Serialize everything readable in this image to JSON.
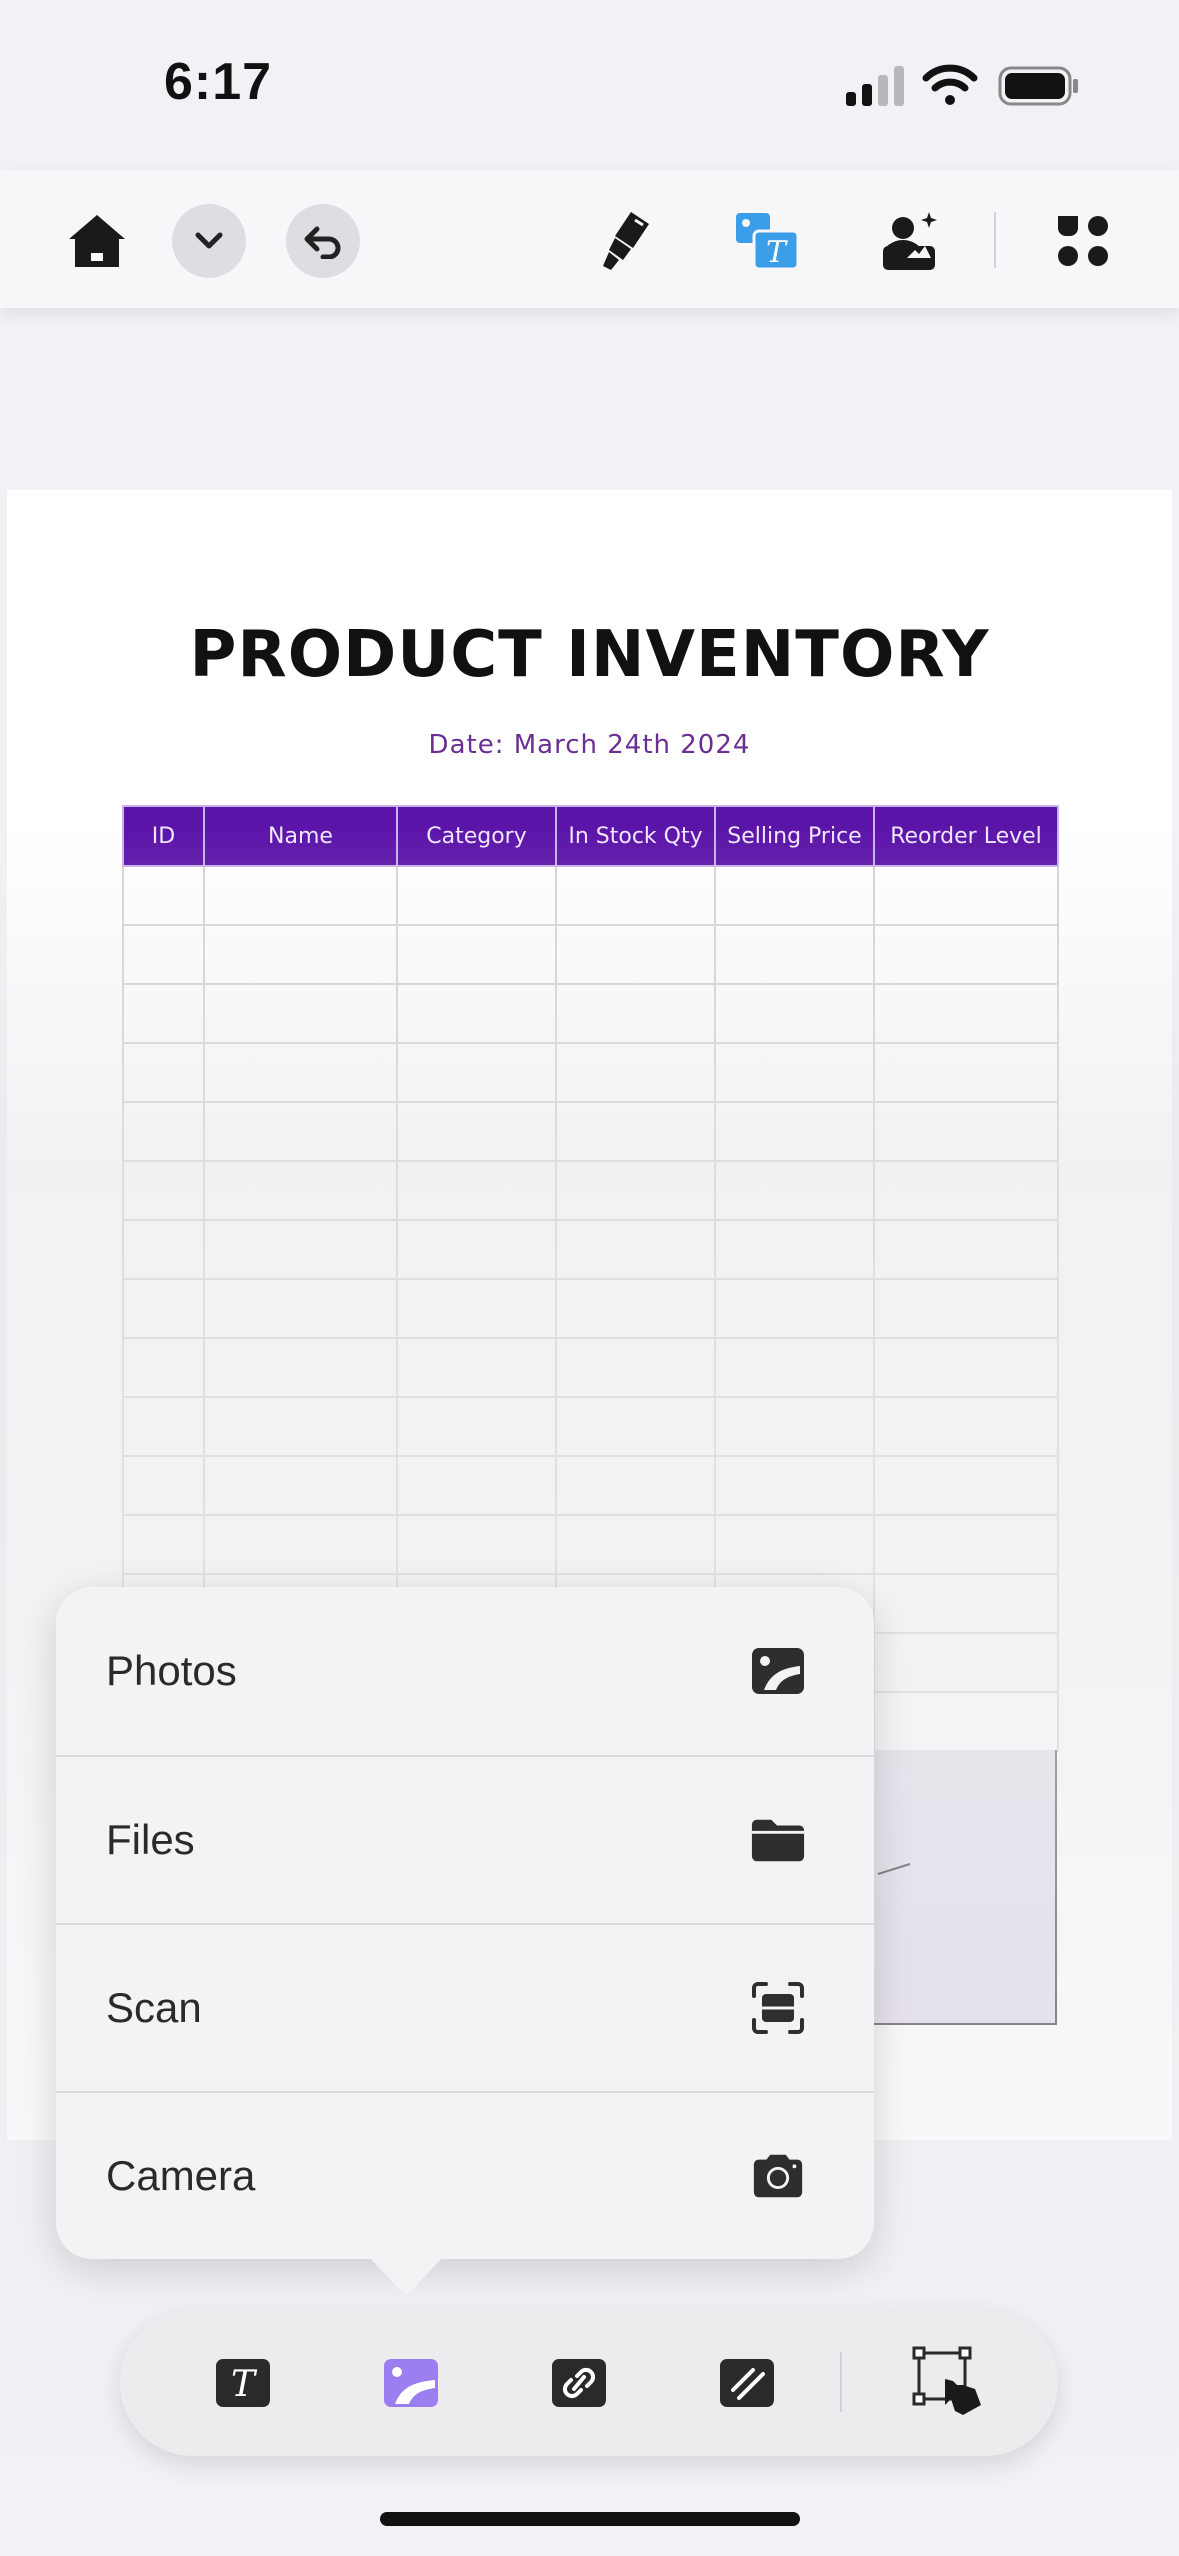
{
  "status_bar": {
    "time": "6:17"
  },
  "top_toolbar": {
    "icons": [
      "home-icon",
      "chevron-down-icon",
      "undo-icon",
      "highlighter-icon",
      "image-text-icon",
      "ai-person-icon",
      "apps-grid-icon"
    ],
    "active_color": "#3a9ee8"
  },
  "document": {
    "title": "PRODUCT INVENTORY",
    "date": "Date: March 24th 2024",
    "table": {
      "headers": [
        "ID",
        "Name",
        "Category",
        "In Stock Qty",
        "Selling Price",
        "Reorder Level"
      ],
      "row_count": 15
    },
    "header_color": "#5b14a8"
  },
  "insert_menu": {
    "items": [
      {
        "label": "Photos",
        "icon": "photo-icon"
      },
      {
        "label": "Files",
        "icon": "folder-icon"
      },
      {
        "label": "Scan",
        "icon": "scan-icon"
      },
      {
        "label": "Camera",
        "icon": "camera-icon"
      }
    ]
  },
  "bottom_toolbar": {
    "icons": [
      "text-tool-icon",
      "image-tool-icon",
      "link-tool-icon",
      "shape-tool-icon",
      "select-tool-icon"
    ],
    "active": "image-tool-icon",
    "active_color": "#9b7ff0"
  }
}
